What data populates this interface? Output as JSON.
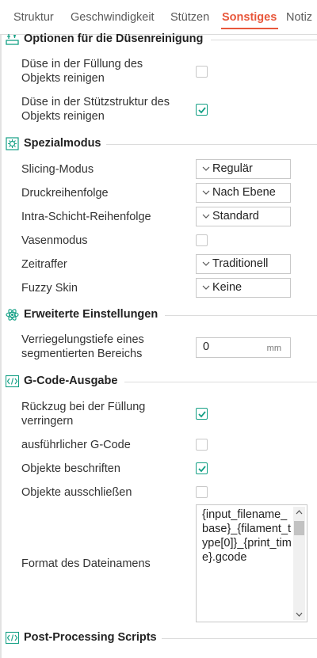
{
  "tabs": [
    {
      "label": "Struktur",
      "active": false
    },
    {
      "label": "Geschwindigkeit",
      "active": false
    },
    {
      "label": "Stützen",
      "active": false
    },
    {
      "label": "Sonstiges",
      "active": true
    },
    {
      "label": "Notiz",
      "active": false
    }
  ],
  "colors": {
    "accent": "#e8573b",
    "check": "#14a085",
    "section_icon": "#14a085"
  },
  "sections": {
    "nozzle_clean": {
      "title": "Optionen für die Düsenreinigung",
      "icon": "nozzle-clean-icon"
    },
    "special_mode": {
      "title": "Spezialmodus",
      "icon": "special-mode-icon"
    },
    "advanced": {
      "title": "Erweiterte Einstellungen",
      "icon": "atom-icon"
    },
    "gcode": {
      "title": "G-Code-Ausgabe",
      "icon": "code-icon"
    },
    "post": {
      "title": "Post-Processing Scripts",
      "icon": "code-icon"
    }
  },
  "nozzle_clean": {
    "infill_label": "Düse in der Füllung des Objekts reinigen",
    "infill_checked": false,
    "support_label": "Düse in der Stützstruktur des Objekts reinigen",
    "support_checked": true
  },
  "special_mode": {
    "slicing_mode_label": "Slicing-Modus",
    "slicing_mode_value": "Regulär",
    "print_sequence_label": "Druckreihenfolge",
    "print_sequence_value": "Nach Ebene",
    "intra_layer_label": "Intra-Schicht-Reihenfolge",
    "intra_layer_value": "Standard",
    "vase_label": "Vasenmodus",
    "vase_checked": false,
    "timelapse_label": "Zeitraffer",
    "timelapse_value": "Traditionell",
    "fuzzy_label": "Fuzzy Skin",
    "fuzzy_value": "Keine"
  },
  "advanced": {
    "interlock_label": "Verriegelungstiefe eines segmentierten Bereichs",
    "interlock_value": "0",
    "interlock_unit": "mm"
  },
  "gcode": {
    "reduce_retract_label": "Rückzug bei der Füllung verringern",
    "reduce_retract_checked": true,
    "verbose_label": "ausführlicher G-Code",
    "verbose_checked": false,
    "label_objects_label": "Objekte beschriften",
    "label_objects_checked": true,
    "exclude_label": "Objekte ausschließen",
    "exclude_checked": false,
    "filename_label": "Format des Dateinamens",
    "filename_value": "{input_filename_base}_{filament_type[0]}_{print_time}.gcode"
  }
}
